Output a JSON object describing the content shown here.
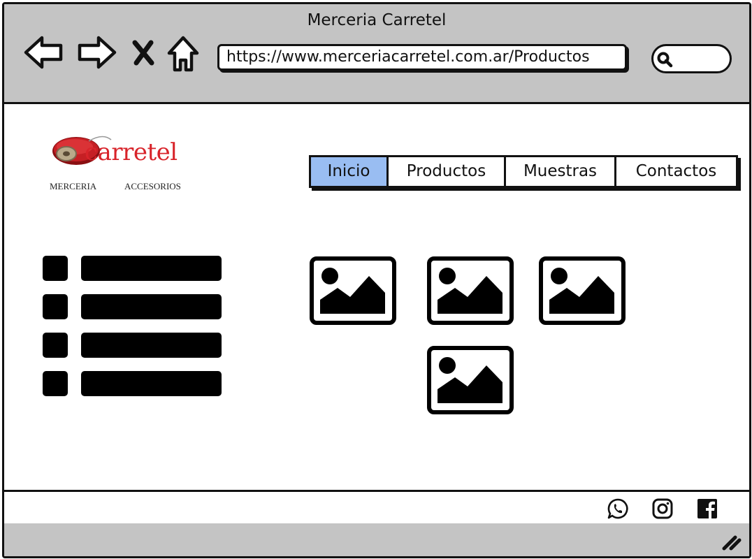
{
  "window": {
    "title": "Merceria Carretel"
  },
  "toolbar": {
    "back_icon": "arrow-left-icon",
    "forward_icon": "arrow-right-icon",
    "stop_icon": "close-icon",
    "home_icon": "home-icon"
  },
  "address_bar": {
    "url": "https://www.merceriacarretel.com.ar/Productos"
  },
  "search": {
    "icon": "search-icon",
    "value": ""
  },
  "logo": {
    "word": "carretel",
    "left_text": "MERCERIA",
    "right_text": "ACCESORIOS",
    "color": "#d8232a"
  },
  "menu": {
    "items": [
      {
        "label": "Inicio",
        "active": true
      },
      {
        "label": "Productos",
        "active": false
      },
      {
        "label": "Muestras",
        "active": false
      },
      {
        "label": "Contactos",
        "active": false
      }
    ],
    "active_color": "#99bdf2"
  },
  "list": {
    "rows": 4
  },
  "gallery": {
    "image_count": 4,
    "icon": "image-placeholder-icon"
  },
  "footer": {
    "social": [
      "whatsapp-icon",
      "instagram-icon",
      "facebook-icon"
    ]
  },
  "colors": {
    "chrome": "#c4c4c4",
    "ink": "#111111"
  }
}
